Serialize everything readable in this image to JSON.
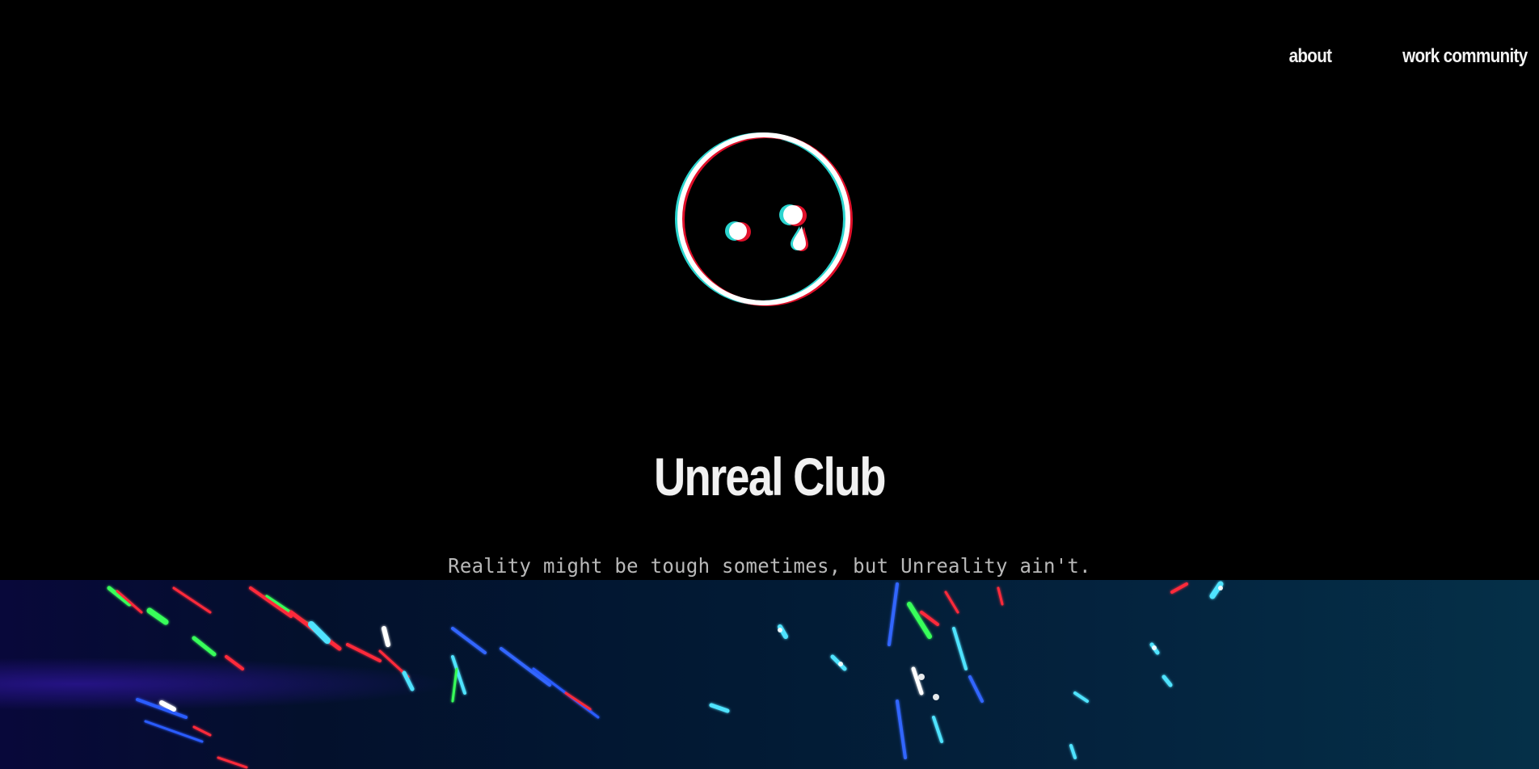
{
  "nav": {
    "items": [
      {
        "label": "about"
      },
      {
        "label": "work community"
      }
    ]
  },
  "logo": {
    "icon": "sad-face-glitch-icon",
    "colors": {
      "outline": "#ffffff",
      "shadow_cyan": "#2bd4cf",
      "shadow_red": "#e0102a"
    }
  },
  "hero": {
    "title": "Unreal Club",
    "tagline": "Reality might be tough sometimes, but Unreality ain't."
  },
  "banner": {
    "icon": "neon-abstract-image",
    "colors": {
      "base": "#031a34",
      "neon_green": "#37ff5a",
      "neon_red": "#ff2a3a",
      "neon_cyan": "#4fe3ff",
      "neon_blue": "#2a5cff"
    }
  }
}
